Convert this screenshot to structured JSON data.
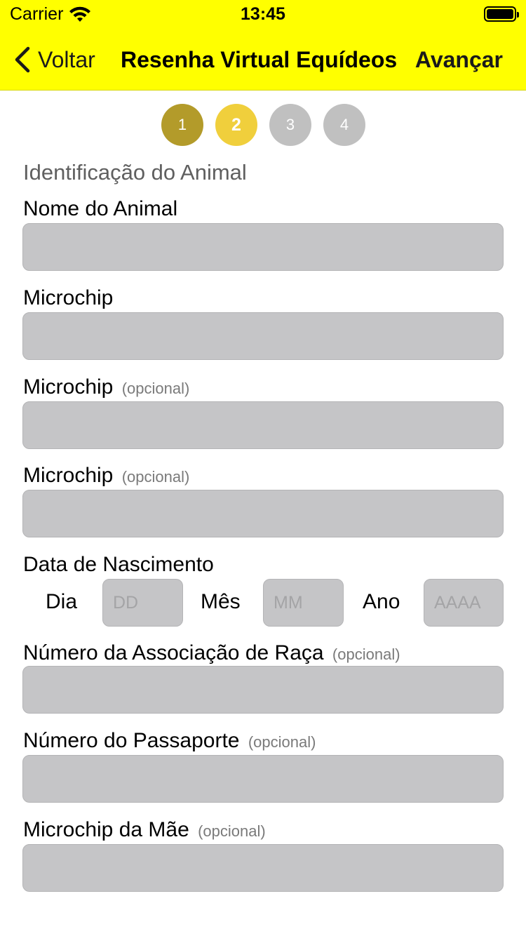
{
  "status_bar": {
    "carrier": "Carrier",
    "time": "13:45"
  },
  "nav": {
    "back_label": "Voltar",
    "title": "Resenha Virtual Equídeos",
    "next_label": "Avançar"
  },
  "steps": [
    "1",
    "2",
    "3",
    "4"
  ],
  "form": {
    "section_title": "Identificação do Animal",
    "optional_label": "(opcional)",
    "animal_name_label": "Nome do Animal",
    "microchip_label": "Microchip",
    "microchip2_label": "Microchip",
    "microchip3_label": "Microchip",
    "birth_date_label": "Data de Nascimento",
    "day_label": "Dia",
    "day_placeholder": "DD",
    "month_label": "Mês",
    "month_placeholder": "MM",
    "year_label": "Ano",
    "year_placeholder": "AAAA",
    "breed_assoc_label": "Número da Associação de Raça",
    "passport_label": "Número do Passaporte",
    "mother_microchip_label": "Microchip da Mãe"
  },
  "colors": {
    "header_bg": "#ffff00",
    "step_done": "#b39b2a",
    "step_current": "#f0cf3c",
    "step_todo": "#c0c0c0",
    "field_bg": "#c5c5c7"
  }
}
